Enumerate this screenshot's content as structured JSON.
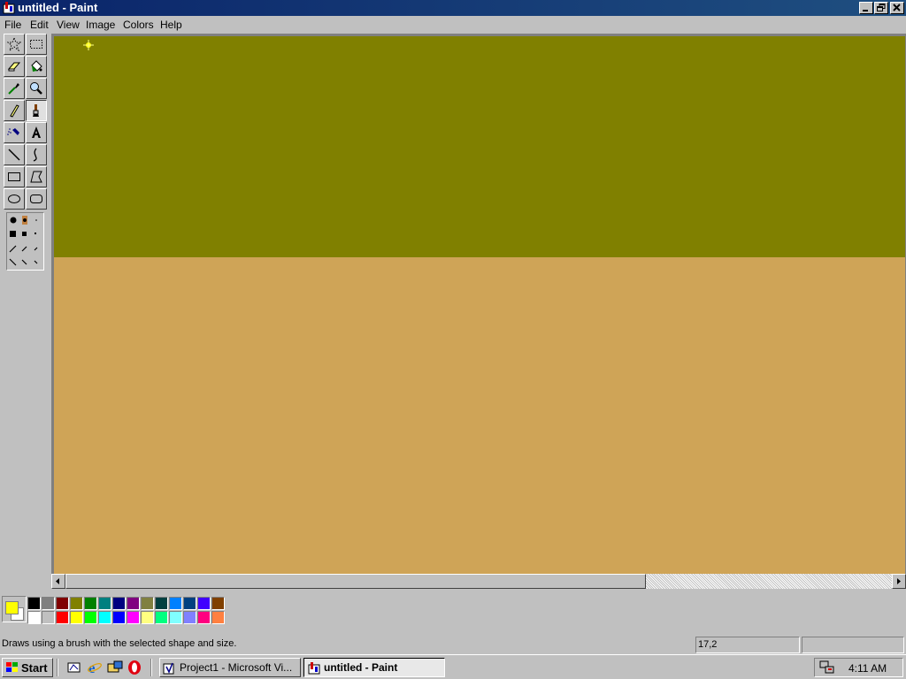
{
  "window": {
    "title": "untitled - Paint",
    "controls": [
      "minimize-icon",
      "restore-icon",
      "close-icon"
    ]
  },
  "menu": {
    "items": [
      {
        "label": "File"
      },
      {
        "label": "Edit"
      },
      {
        "label": "View"
      },
      {
        "label": "Image"
      },
      {
        "label": "Colors"
      },
      {
        "label": "Help"
      }
    ]
  },
  "toolbox": {
    "tools": [
      {
        "name": "free-form-select",
        "icon": "star-select-icon",
        "active": false
      },
      {
        "name": "select",
        "icon": "rect-select-icon",
        "active": false
      },
      {
        "name": "eraser",
        "icon": "eraser-icon",
        "active": false
      },
      {
        "name": "fill",
        "icon": "fill-bucket-icon",
        "active": false
      },
      {
        "name": "pick-color",
        "icon": "eyedropper-icon",
        "active": false
      },
      {
        "name": "magnifier",
        "icon": "magnifier-icon",
        "active": false
      },
      {
        "name": "pencil",
        "icon": "pencil-icon",
        "active": false
      },
      {
        "name": "brush",
        "icon": "brush-icon",
        "active": true
      },
      {
        "name": "airbrush",
        "icon": "airbrush-icon",
        "active": false
      },
      {
        "name": "text",
        "icon": "text-icon",
        "active": false
      },
      {
        "name": "line",
        "icon": "line-icon",
        "active": false
      },
      {
        "name": "curve",
        "icon": "curve-icon",
        "active": false
      },
      {
        "name": "rectangle",
        "icon": "rectangle-icon",
        "active": false
      },
      {
        "name": "polygon",
        "icon": "polygon-icon",
        "active": false
      },
      {
        "name": "ellipse",
        "icon": "ellipse-icon",
        "active": false
      },
      {
        "name": "rounded-rectangle",
        "icon": "rounded-rect-icon",
        "active": false
      }
    ]
  },
  "canvas": {
    "top_color": "#808000",
    "bottom_color": "#cfa457",
    "cursor_icon": "sparkle-cursor-icon"
  },
  "palette": {
    "foreground": "#ffff00",
    "background": "#ffffff",
    "row1": [
      "#000000",
      "#808080",
      "#800000",
      "#808000",
      "#008000",
      "#008080",
      "#000080",
      "#800080",
      "#808040",
      "#004040",
      "#0080ff",
      "#004080",
      "#4000ff",
      "#804000"
    ],
    "row2": [
      "#ffffff",
      "#c0c0c0",
      "#ff0000",
      "#ffff00",
      "#00ff00",
      "#00ffff",
      "#0000ff",
      "#ff00ff",
      "#ffff80",
      "#00ff80",
      "#80ffff",
      "#8080ff",
      "#ff0080",
      "#ff8040"
    ]
  },
  "status": {
    "help_text": "Draws using a brush with the selected shape and size.",
    "coords": "17,2",
    "size": ""
  },
  "taskbar": {
    "start_label": "Start",
    "quick_launch": [
      "show-desktop-icon",
      "internet-explorer-icon",
      "outlook-icon",
      "opera-icon"
    ],
    "tasks": [
      {
        "label": "Project1 - Microsoft Vi...",
        "icon": "vb-project-icon",
        "active": false
      },
      {
        "label": "untitled - Paint",
        "icon": "paint-icon",
        "active": true
      }
    ],
    "tray_icon": "network-tray-icon",
    "clock": "4:11 AM"
  }
}
